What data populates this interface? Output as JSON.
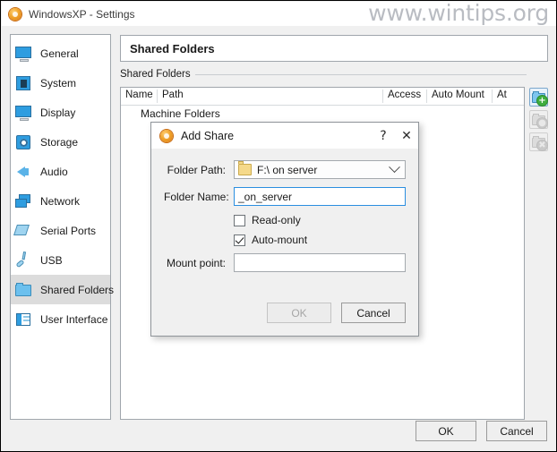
{
  "window": {
    "title": "WindowsXP - Settings",
    "icon": "virtualbox-icon"
  },
  "watermark": "www.wintips.org",
  "sidebar": {
    "items": [
      {
        "label": "General",
        "icon": "monitor-icon",
        "selected": false
      },
      {
        "label": "System",
        "icon": "chip-icon",
        "selected": false
      },
      {
        "label": "Display",
        "icon": "monitor-icon",
        "selected": false
      },
      {
        "label": "Storage",
        "icon": "disk-icon",
        "selected": false
      },
      {
        "label": "Audio",
        "icon": "speaker-icon",
        "selected": false
      },
      {
        "label": "Network",
        "icon": "network-icon",
        "selected": false
      },
      {
        "label": "Serial Ports",
        "icon": "serial-port-icon",
        "selected": false
      },
      {
        "label": "USB",
        "icon": "usb-icon",
        "selected": false
      },
      {
        "label": "Shared Folders",
        "icon": "folder-icon",
        "selected": true
      },
      {
        "label": "User Interface",
        "icon": "user-interface-icon",
        "selected": false
      }
    ]
  },
  "pane": {
    "header_title": "Shared Folders",
    "group_label": "Shared Folders"
  },
  "table": {
    "columns": [
      "Name",
      "Path",
      "Access",
      "Auto Mount",
      "At"
    ],
    "group_row": "Machine Folders",
    "rows": []
  },
  "toolbar": {
    "buttons": [
      {
        "name": "add-shared-folder",
        "enabled": true,
        "badge": "+"
      },
      {
        "name": "edit-shared-folder",
        "enabled": false,
        "badge": "●"
      },
      {
        "name": "remove-shared-folder",
        "enabled": false,
        "badge": "✖"
      }
    ]
  },
  "footer": {
    "ok_label": "OK",
    "cancel_label": "Cancel"
  },
  "dialog": {
    "title": "Add Share",
    "icon": "virtualbox-icon",
    "help_glyph": "?",
    "close_glyph": "✕",
    "folder_path": {
      "label": "Folder Path:",
      "value": "F:\\ on server"
    },
    "folder_name": {
      "label": "Folder Name:",
      "value": "_on_server"
    },
    "read_only": {
      "label": "Read-only",
      "checked": false
    },
    "auto_mount": {
      "label": "Auto-mount",
      "checked": true
    },
    "mount_point": {
      "label": "Mount point:",
      "value": "",
      "placeholder": ""
    },
    "ok_label": "OK",
    "ok_enabled": false,
    "cancel_label": "Cancel"
  }
}
